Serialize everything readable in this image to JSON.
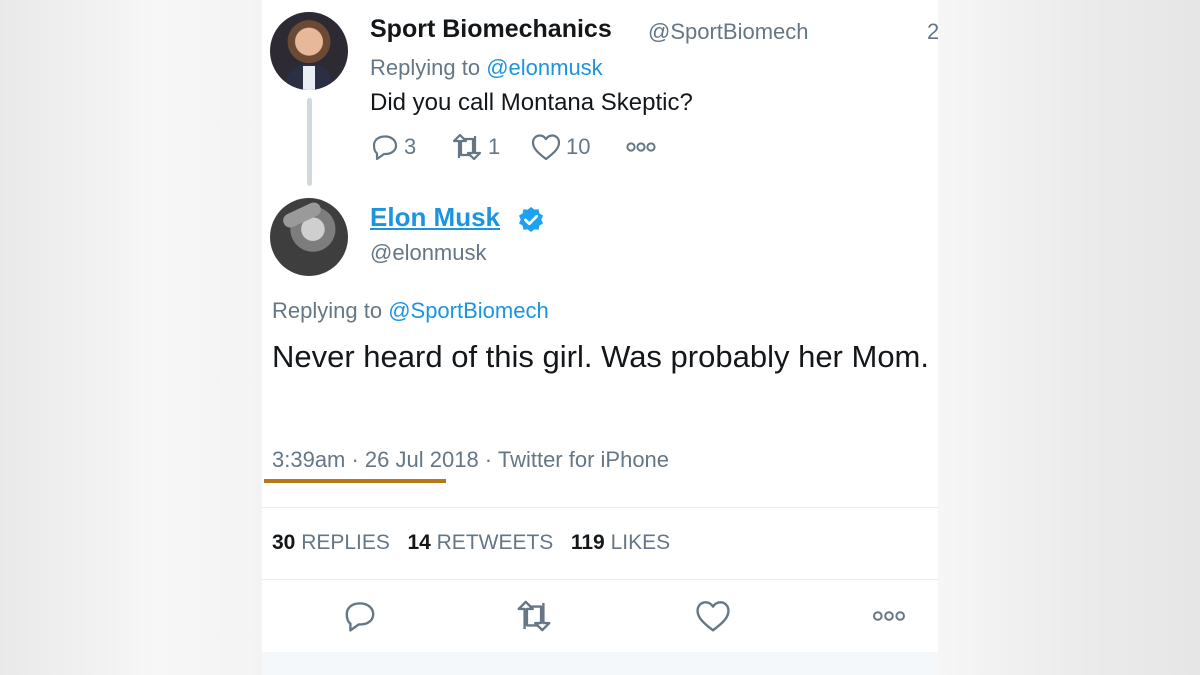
{
  "parent_tweet": {
    "name": "Sport Biomechanics",
    "handle": "@SportBiomech",
    "time": "2",
    "replying_prefix": "Replying to ",
    "replying_to": "@elonmusk",
    "text": "Did you call Montana Skeptic?",
    "reply_count": "3",
    "retweet_count": "1",
    "like_count": "10"
  },
  "main_tweet": {
    "name": "Elon Musk",
    "handle": "@elonmusk",
    "replying_prefix": "Replying to ",
    "replying_to": "@SportBiomech",
    "text": "Never heard of this girl. Was probably her Mom.",
    "meta": "3:39am · 26 Jul 2018 · Twitter for iPhone",
    "stats": {
      "replies_count": "30",
      "replies_label": "REPLIES",
      "retweets_count": "14",
      "retweets_label": "RETWEETS",
      "likes_count": "119",
      "likes_label": "LIKES"
    }
  },
  "colors": {
    "link": "#1b95e0",
    "text": "#14171a",
    "muted": "#657786",
    "highlight_underline": "#b7781a"
  },
  "icons": [
    "reply-icon",
    "retweet-icon",
    "like-icon",
    "more-icon",
    "verified-badge-icon"
  ]
}
